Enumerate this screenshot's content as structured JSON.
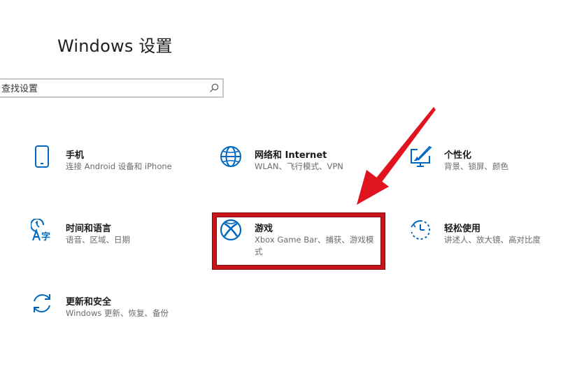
{
  "page": {
    "title": "Windows 设置"
  },
  "search": {
    "placeholder": "查找设置",
    "icon": "search-icon"
  },
  "tiles": [
    {
      "key": "phone",
      "name": "手机",
      "desc": "连接 Android 设备和 iPhone",
      "icon": "phone-icon"
    },
    {
      "key": "network",
      "name": "网络和 Internet",
      "desc": "WLAN、飞行模式、VPN",
      "icon": "globe-icon"
    },
    {
      "key": "personalization",
      "name": "个性化",
      "desc": "背景、锁屏、颜色",
      "icon": "personalization-icon"
    },
    {
      "key": "time-language",
      "name": "时间和语言",
      "desc": "语音、区域、日期",
      "icon": "time-language-icon"
    },
    {
      "key": "gaming",
      "name": "游戏",
      "desc": "Xbox Game Bar、捕获、游戏模式",
      "icon": "xbox-icon"
    },
    {
      "key": "ease-of-access",
      "name": "轻松使用",
      "desc": "讲述人、放大镜、高对比度",
      "icon": "ease-of-access-icon"
    },
    {
      "key": "update-security",
      "name": "更新和安全",
      "desc": "Windows 更新、恢复、备份",
      "icon": "update-icon"
    }
  ],
  "colors": {
    "accent": "#0067c0",
    "highlight": "#c8141b",
    "arrow": "#e0141e"
  }
}
